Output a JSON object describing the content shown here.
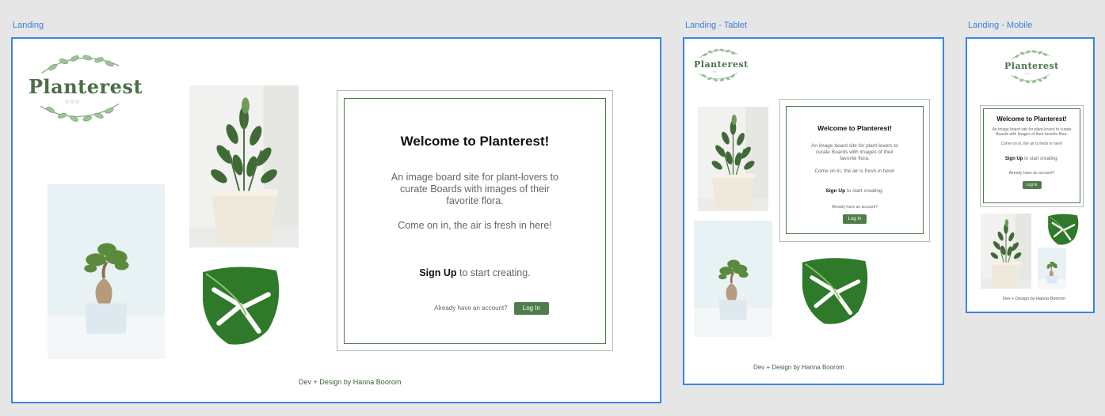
{
  "frames": {
    "desktop": {
      "label": "Landing"
    },
    "tablet": {
      "label": "Landing - Tablet"
    },
    "mobile": {
      "label": "Landing - Mobile"
    }
  },
  "logo": {
    "wordmark": "Planterest",
    "dots": "○○○"
  },
  "card": {
    "title": "Welcome to Planterest!",
    "description": "An image board site for plant-lovers to curate Boards with images of their favorite flora.",
    "tagline": "Come on in, the air is fresh in here!",
    "signup_link": "Sign Up",
    "signup_suffix": " to start creating.",
    "login_prompt": "Already have an account?",
    "login_button": "Log In"
  },
  "footer": {
    "credit": "Dev + Design by Hanna Boorom"
  },
  "colors": {
    "brand_green": "#4f7c4b",
    "frame_border": "#3b85e6",
    "canvas_bg": "#e6e6e6"
  }
}
